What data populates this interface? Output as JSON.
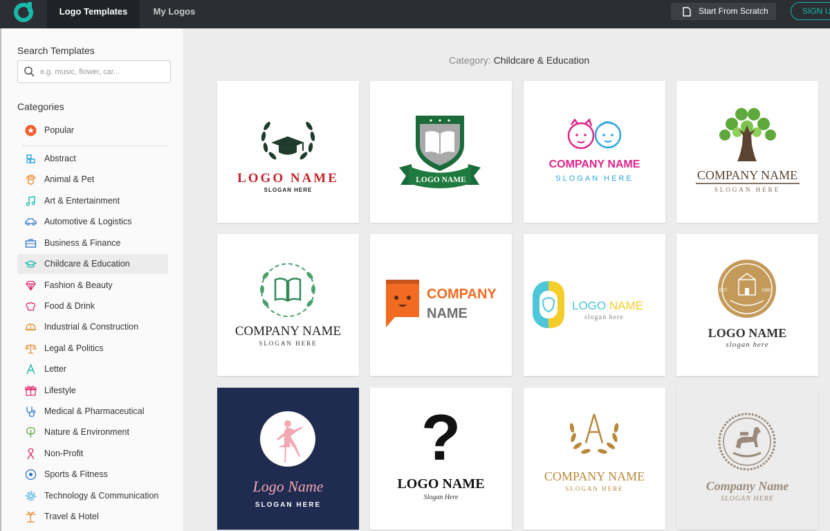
{
  "header": {
    "tabs": [
      {
        "label": "Logo Templates",
        "active": true
      },
      {
        "label": "My Logos",
        "active": false
      }
    ],
    "start_from_scratch": "Start From Scratch",
    "sign_up": "SIGN UP"
  },
  "sidebar": {
    "search_title": "Search Templates",
    "search_placeholder": "e.g. music, flower, car...",
    "categories_title": "Categories",
    "categories": [
      {
        "label": "Popular",
        "icon": "star-icon"
      },
      {
        "label": "Abstract",
        "icon": "abstract-icon"
      },
      {
        "label": "Animal & Pet",
        "icon": "paw-icon"
      },
      {
        "label": "Art & Entertainment",
        "icon": "music-note-icon"
      },
      {
        "label": "Automotive & Logistics",
        "icon": "car-icon"
      },
      {
        "label": "Business & Finance",
        "icon": "briefcase-icon"
      },
      {
        "label": "Childcare & Education",
        "icon": "graduation-cap-icon",
        "selected": true
      },
      {
        "label": "Fashion & Beauty",
        "icon": "diamond-icon"
      },
      {
        "label": "Food & Drink",
        "icon": "chef-hat-icon"
      },
      {
        "label": "Industrial & Construction",
        "icon": "hard-hat-icon"
      },
      {
        "label": "Legal & Politics",
        "icon": "scales-icon"
      },
      {
        "label": "Letter",
        "icon": "letter-a-icon"
      },
      {
        "label": "Lifestyle",
        "icon": "gift-icon"
      },
      {
        "label": "Medical & Pharmaceutical",
        "icon": "stethoscope-icon"
      },
      {
        "label": "Nature & Environment",
        "icon": "tree-icon"
      },
      {
        "label": "Non-Profit",
        "icon": "ribbon-icon"
      },
      {
        "label": "Sports & Fitness",
        "icon": "soccer-ball-icon"
      },
      {
        "label": "Technology & Communication",
        "icon": "gear-icon"
      },
      {
        "label": "Travel & Hotel",
        "icon": "palm-tree-icon"
      }
    ]
  },
  "main": {
    "category_key": "Category:",
    "category_value": "Childcare & Education",
    "templates": [
      {
        "name": "LOGO NAME",
        "slogan": "SLOGAN HERE"
      },
      {
        "name": "LOGO NAME"
      },
      {
        "name": "COMPANY NAME",
        "slogan": "SLOGAN HERE"
      },
      {
        "name": "COMPANY NAME",
        "slogan": "SLOGAN HERE"
      },
      {
        "name": "COMPANY NAME",
        "slogan": "SLOGAN HERE"
      },
      {
        "name_line1": "COMPANY",
        "name_line2": "NAME"
      },
      {
        "name_a": "LOGO",
        "name_b": "NAME",
        "slogan": "slogan here"
      },
      {
        "name": "LOGO NAME",
        "slogan": "slogan here",
        "badge_left": "EST.",
        "badge_right": "1985"
      },
      {
        "name": "Logo Name",
        "slogan": "SLOGAN HERE"
      },
      {
        "name": "LOGO NAME",
        "slogan": "Slogan Here"
      },
      {
        "name": "COMPANY NAME",
        "slogan": "SLOGAN HERE"
      },
      {
        "name": "Company Name",
        "slogan": "SLOGAN HERE"
      }
    ]
  },
  "colors": {
    "accent": "#19b8a9",
    "topbar": "#2b2e33",
    "wreath_dark": "#1e3b2b",
    "logo_red": "#c0252c",
    "shield_green": "#1a6a3a",
    "pink": "#e0238a",
    "sky_blue": "#2aa3e0",
    "tree_brown": "#5b4332",
    "leaf_green": "#5fa93c",
    "orange": "#f26b22",
    "yellow": "#f5cd2b",
    "cyan": "#4ec6d9",
    "gold": "#c49a5a",
    "navy": "#1f2b4f",
    "ballet_pink": "#f3a9b3",
    "bronze": "#b8873a",
    "taupe": "#9a8a7b"
  }
}
